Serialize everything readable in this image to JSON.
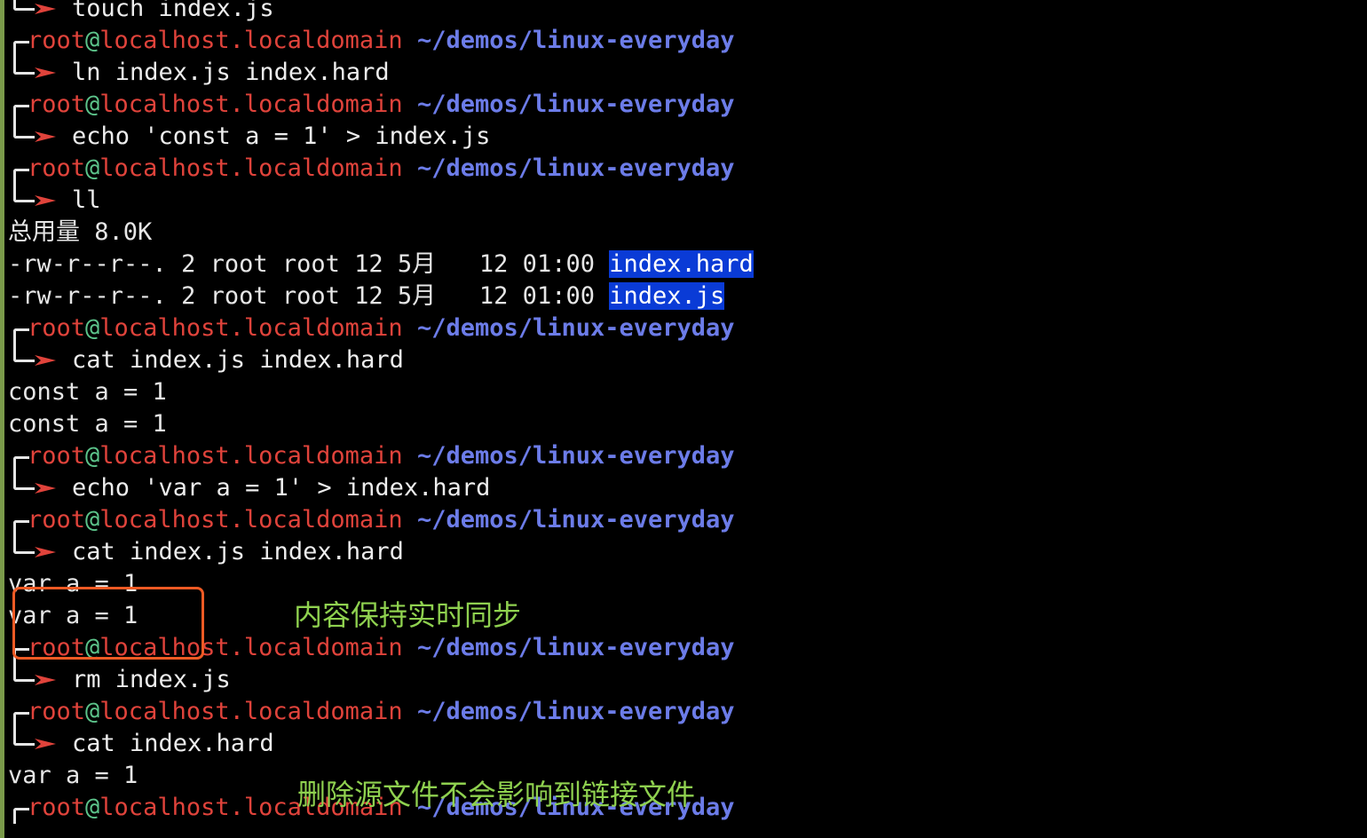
{
  "prompt": {
    "user": "root",
    "at": "@",
    "host": "localhost.localdomain",
    "path": "~/demos/linux-everyday"
  },
  "commands": [
    "touch index.js",
    "ln index.js index.hard",
    "echo 'const a = 1' > index.js",
    "ll",
    "cat index.js index.hard",
    "echo 'var a = 1' > index.hard",
    "cat index.js index.hard",
    "rm index.js",
    "cat index.hard"
  ],
  "outputs": {
    "ll_total": "总用量 8.0K",
    "ll_rows": [
      {
        "meta": "-rw-r--r--. 2 root root 12 5月   12 01:00 ",
        "name": "index.hard"
      },
      {
        "meta": "-rw-r--r--. 2 root root 12 5月   12 01:00 ",
        "name": "index.js"
      }
    ],
    "cat1": [
      "const a = 1",
      "const a = 1"
    ],
    "cat2": [
      "var a = 1",
      "var a = 1"
    ],
    "cat3": [
      "var a = 1"
    ]
  },
  "annotations": {
    "sync_note": "内容保持实时同步",
    "delete_note": "删除源文件不会影响到链接文件"
  },
  "colors": {
    "user": "#e0433b",
    "at": "#5cc38a",
    "path": "#6c7ce8",
    "arrow": "#e0433b",
    "highlight": "#0a3bd6",
    "annotation": "#8fd14f",
    "box": "#ee5a24"
  }
}
